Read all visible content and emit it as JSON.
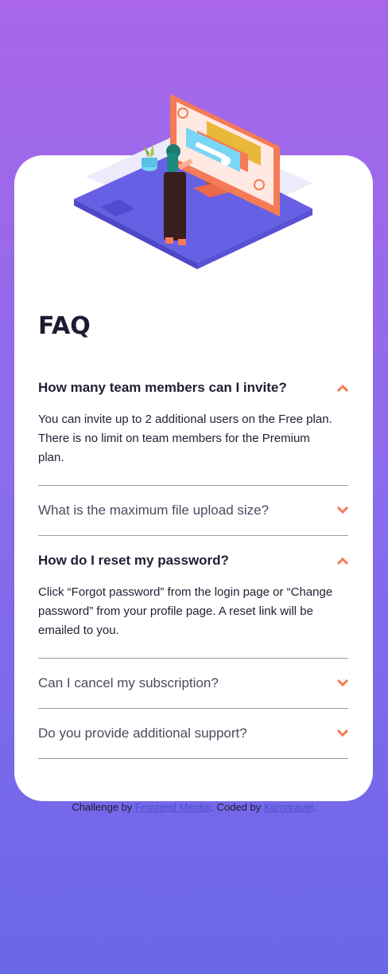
{
  "page": {
    "title": "FAQ"
  },
  "faq": [
    {
      "question": "How many team members can I invite?",
      "answer": "You can invite up to 2 additional users on the Free plan. There is no limit on team members for the Premium plan.",
      "open": true
    },
    {
      "question": "What is the maximum file upload size?",
      "answer": "",
      "open": false
    },
    {
      "question": "How do I reset my password?",
      "answer": "Click “Forgot password” from the login page or “Change password” from your profile page. A reset link will be emailed to you.",
      "open": true
    },
    {
      "question": "Can I cancel my subscription?",
      "answer": "",
      "open": false
    },
    {
      "question": "Do you provide additional support?",
      "answer": "",
      "open": false
    }
  ],
  "footer": {
    "prefix": "Challenge by",
    "link1": "Frontend Mentor",
    "middle": ". Coded by",
    "link2": "Kumaravel",
    "suffix": "."
  },
  "colors": {
    "accent": "#f47b56",
    "open_question": "#1f2033",
    "closed_question": "#4a4b5e"
  }
}
